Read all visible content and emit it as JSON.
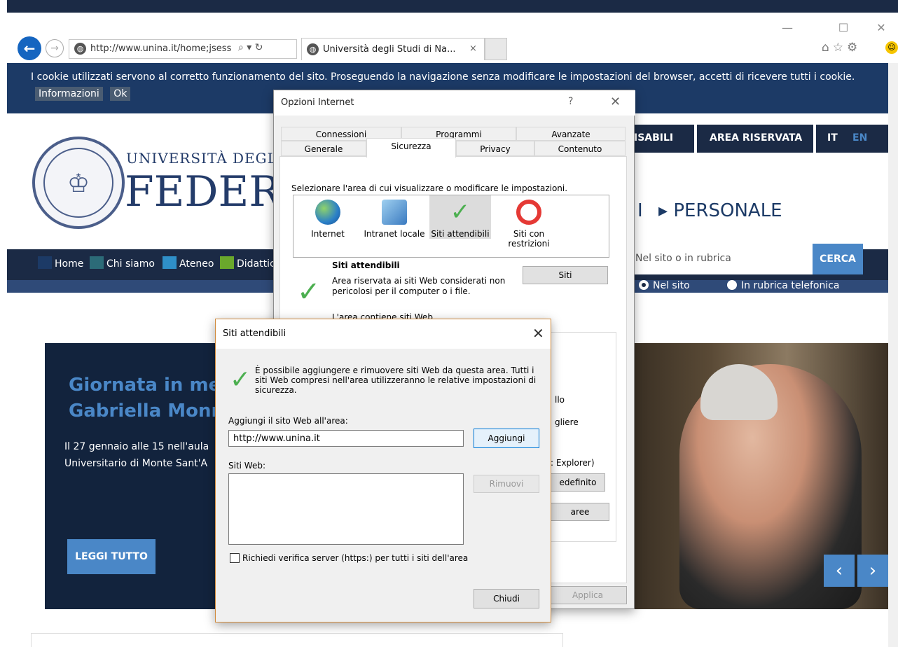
{
  "browser": {
    "address": "http://www.unina.it/home;jsess",
    "tab_title": "Università degli Studi di Na...",
    "tab_close": "×",
    "win_min": "—",
    "win_max": "☐",
    "win_close": "✕",
    "addr_actions": "⌕ ▾ ↻",
    "right_icons": "⌂☆⚙"
  },
  "cookie_bar": {
    "text": "I cookie utilizzati servono al corretto funzionamento del sito. Proseguendo la navigazione senza modificare le impostazioni del browser, accetti di ricevere tutti i cookie.",
    "info_label": "Informazioni",
    "ok_label": "Ok"
  },
  "header": {
    "right_links": [
      "ISABILI",
      "AREA RISERVATA",
      "IT",
      "EN"
    ],
    "university_name": "UNIVERSITÀ DEGLI STUD",
    "federico": "FEDERIC",
    "personale": "▸ PERSONALE",
    "bar": "I"
  },
  "nav": {
    "items": [
      {
        "label": "Home",
        "color": "#1c3a66"
      },
      {
        "label": "Chi siamo",
        "color": "#2c6b78"
      },
      {
        "label": "Ateneo",
        "color": "#2f8fc8"
      },
      {
        "label": "Didattic",
        "color": "#6aa82c"
      }
    ]
  },
  "search": {
    "placeholder": "Nel sito o in rubrica",
    "button": "CERCA",
    "radio_site": "Nel sito",
    "radio_phone": "In rubrica telefonica"
  },
  "hero": {
    "title_line1": "Giornata in me",
    "title_line2": "Gabriella Monr",
    "text_line1": "Il 27 gennaio alle 15 nell'aula",
    "text_line2": "Universitario di Monte Sant'A",
    "button": "LEGGI TUTTO"
  },
  "opzioni": {
    "title": "Opzioni Internet",
    "help": "?",
    "close": "✕",
    "tabs_row1": [
      "Connessioni",
      "Programmi",
      "Avanzate"
    ],
    "tabs_row2": [
      "Generale",
      "Sicurezza",
      "Privacy",
      "Contenuto"
    ],
    "zone_label": "Selezionare l'area di cui visualizzare o modificare le impostazioni.",
    "zones": [
      {
        "name": "Internet"
      },
      {
        "name": "Intranet locale"
      },
      {
        "name": "Siti attendibili"
      },
      {
        "name": "Siti con restrizioni"
      }
    ],
    "zone_title": "Siti attendibili",
    "zone_desc": "Area riservata ai siti Web considerati non pericolosi per il computer o i file.",
    "siti_button": "Siti",
    "area_contains": "L'area contiene siti Web.",
    "partial_lines": [
      "llo",
      "gliere",
      ": Explorer)"
    ],
    "predefinito": "edefinito",
    "aree": "aree",
    "applica": "Applica"
  },
  "siti_dialog": {
    "title": "Siti attendibili",
    "close": "✕",
    "info": "È possibile aggiungere e rimuovere siti Web da questa area. Tutti i siti Web compresi nell'area utilizzeranno le relative impostazioni di sicurezza.",
    "add_label": "Aggiungi il sito Web all'area:",
    "add_value": "http://www.unina.it",
    "add_button": "Aggiungi",
    "list_label": "Siti Web:",
    "remove_button": "Rimuovi",
    "https_label": "Richiedi verifica server (https:) per tutti i siti dell'area",
    "close_button": "Chiudi"
  }
}
